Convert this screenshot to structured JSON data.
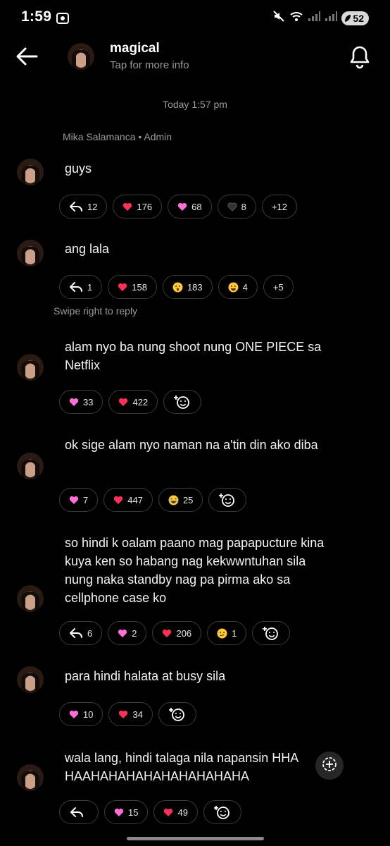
{
  "status_bar": {
    "time": "1:59",
    "battery": "52"
  },
  "header": {
    "title": "magical",
    "subtitle": "Tap for more info"
  },
  "timestamp": "Today 1:57 pm",
  "sender_line": "Mika Salamanca • Admin",
  "swipe_hint": "Swipe right to reply",
  "colors": {
    "background": "#000000",
    "pill_border": "#3a3a3a",
    "heart_red": "#ff3057",
    "heart_pink": "#ff6fd8",
    "muted_text": "#9a9a9a"
  },
  "messages": [
    {
      "text": "guys",
      "reactions": [
        {
          "icon": "reply-icon",
          "count": "12"
        },
        {
          "icon": "red-heart-icon",
          "count": "176"
        },
        {
          "icon": "pink-heart-icon",
          "count": "68"
        },
        {
          "icon": "black-heart-icon",
          "count": "8"
        },
        {
          "icon": "none",
          "count": "+12"
        }
      ]
    },
    {
      "text": "ang lala",
      "reactions": [
        {
          "icon": "reply-icon",
          "count": "1"
        },
        {
          "icon": "red-heart-icon",
          "count": "158"
        },
        {
          "icon": "surprised-face-icon",
          "count": "183"
        },
        {
          "icon": "grin-face-icon",
          "count": "4"
        },
        {
          "icon": "none",
          "count": "+5"
        }
      ]
    },
    {
      "text": "alam nyo ba nung shoot nung ONE PIECE sa Netflix",
      "reactions": [
        {
          "icon": "pink-heart-icon",
          "count": "33"
        },
        {
          "icon": "red-heart-icon",
          "count": "422"
        },
        {
          "icon": "add-reaction-icon",
          "count": ""
        }
      ]
    },
    {
      "text": "ok sige alam nyo naman na a'tin din ako diba",
      "reactions": [
        {
          "icon": "pink-heart-icon",
          "count": "7"
        },
        {
          "icon": "red-heart-icon",
          "count": "447"
        },
        {
          "icon": "laughing-face-icon",
          "count": "25"
        },
        {
          "icon": "add-reaction-icon",
          "count": ""
        }
      ]
    },
    {
      "text": "so hindi k oalam paano mag papapucture kina kuya ken so habang nag kekwwntuhan sila nung naka standby nag pa pirma ako sa cellphone case ko",
      "reactions": [
        {
          "icon": "reply-icon",
          "count": "6"
        },
        {
          "icon": "pink-heart-icon",
          "count": "2"
        },
        {
          "icon": "red-heart-icon",
          "count": "206"
        },
        {
          "icon": "confused-face-icon",
          "count": "1"
        },
        {
          "icon": "add-reaction-icon",
          "count": ""
        }
      ]
    },
    {
      "text": "para hindi halata at busy sila",
      "reactions": [
        {
          "icon": "pink-heart-icon",
          "count": "10"
        },
        {
          "icon": "red-heart-icon",
          "count": "34"
        },
        {
          "icon": "add-reaction-icon",
          "count": ""
        }
      ]
    },
    {
      "text": "wala lang, hindi talaga nila napansin HHAHAAHAHAHAHAHAHAHAHAHA",
      "reactions": [
        {
          "icon": "reply-icon",
          "count": ""
        },
        {
          "icon": "pink-heart-icon",
          "count": "15"
        },
        {
          "icon": "red-heart-icon",
          "count": "49"
        },
        {
          "icon": "add-reaction-icon",
          "count": ""
        }
      ]
    }
  ]
}
